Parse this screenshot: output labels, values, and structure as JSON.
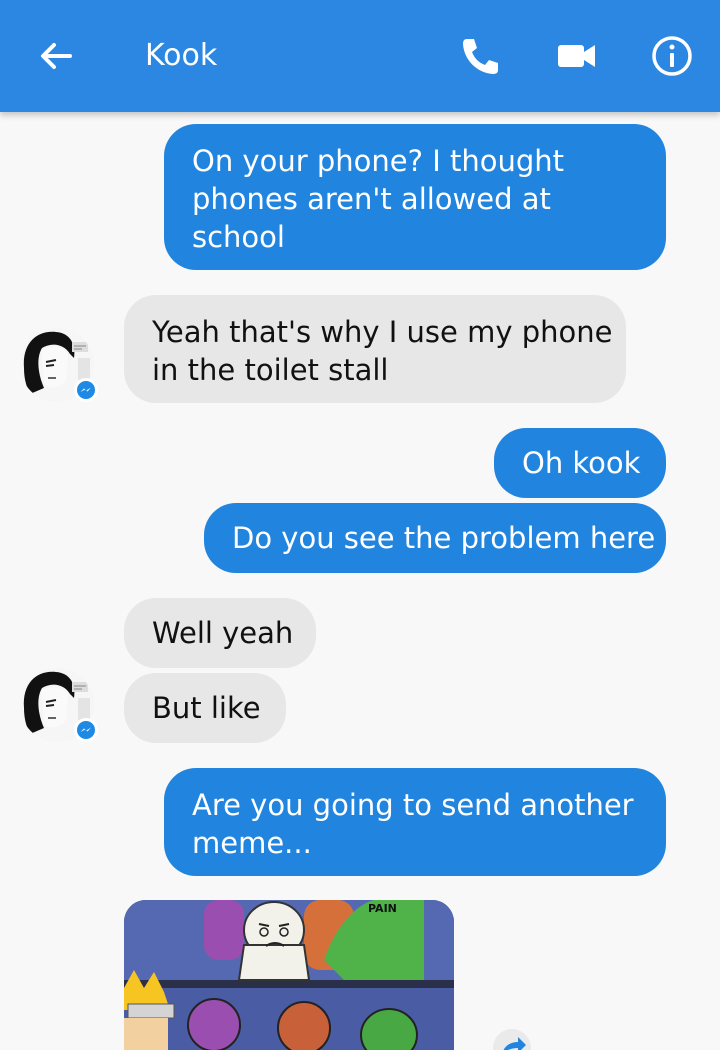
{
  "header": {
    "contact_name": "Kook",
    "icons": [
      "back-arrow-icon",
      "phone-icon",
      "video-camera-icon",
      "info-icon"
    ],
    "background_color": "#2b87e2"
  },
  "messages": [
    {
      "direction": "outgoing",
      "lines": [
        "On your phone? I thought",
        "phones aren't allowed at",
        "school"
      ]
    },
    {
      "direction": "incoming",
      "lines": [
        "Yeah that's why I use my phone",
        "in the toilet stall"
      ]
    },
    {
      "direction": "outgoing",
      "lines": [
        "Oh kook"
      ]
    },
    {
      "direction": "outgoing",
      "lines": [
        "Do you see the problem here"
      ]
    },
    {
      "direction": "incoming",
      "lines": [
        "Well yeah"
      ]
    },
    {
      "direction": "incoming",
      "lines": [
        "But like"
      ]
    },
    {
      "direction": "outgoing",
      "lines": [
        "Are you going to send another",
        "meme..."
      ]
    }
  ],
  "attachment": {
    "type": "image",
    "text": "PAIN"
  },
  "colors": {
    "outgoing_bubble": "#2185e0",
    "incoming_bubble": "#e7e7e7",
    "background": "#f8f8f8"
  }
}
